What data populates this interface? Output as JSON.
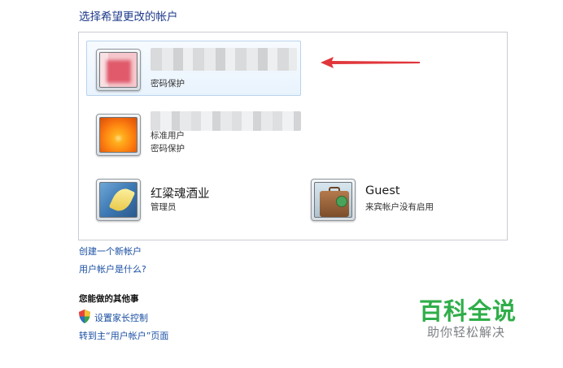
{
  "heading": "选择希望更改的帐户",
  "accounts": [
    {
      "name": "",
      "lines": [
        "密码保护"
      ],
      "selected": true
    },
    {
      "name": "",
      "lines": [
        "标准用户",
        "密码保护"
      ],
      "selected": false
    },
    {
      "name": "红粱魂酒业",
      "lines": [
        "管理员"
      ],
      "selected": false
    },
    {
      "name": "Guest",
      "lines": [
        "来宾帐户没有启用"
      ],
      "selected": false
    }
  ],
  "links": {
    "create_account": "创建一个新帐户",
    "what_is_account": "用户帐户是什么?"
  },
  "other_tasks": {
    "title": "您能做的其他事",
    "parental_controls": "设置家长控制",
    "go_main": "转到主“用户帐户”页面"
  },
  "watermark": {
    "title": "百科全说",
    "subtitle": "助你轻松解决"
  },
  "colors": {
    "link": "#1a4fa3",
    "heading": "#1e3a8a",
    "arrow": "#e0363b",
    "watermark_green": "#2fae49"
  }
}
